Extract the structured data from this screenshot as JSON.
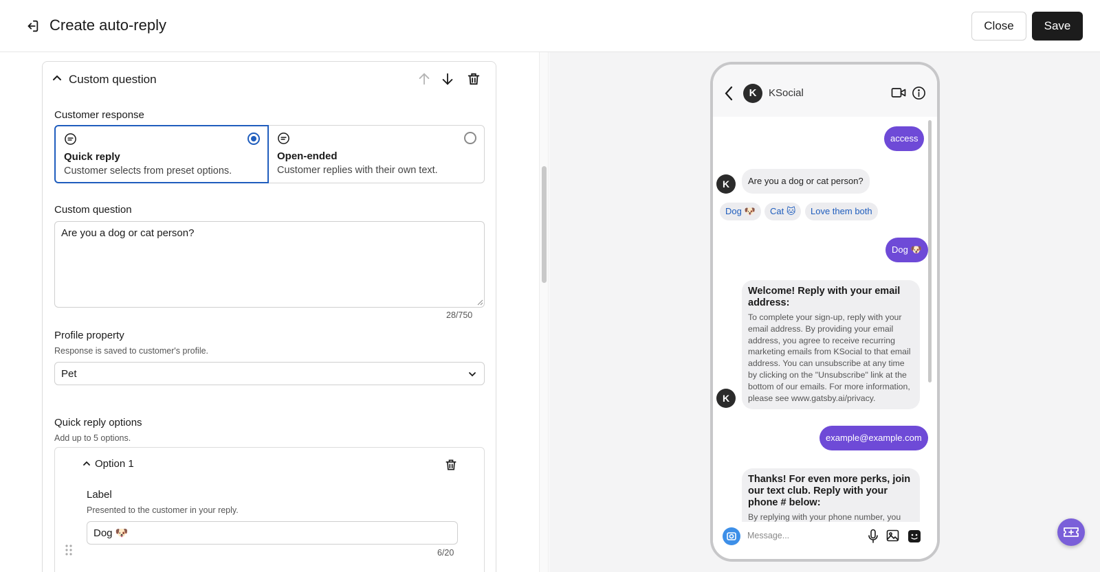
{
  "header": {
    "title": "Create auto-reply",
    "close_label": "Close",
    "save_label": "Save"
  },
  "editor": {
    "card_title": "Custom question",
    "customer_response": {
      "label": "Customer response",
      "options": [
        {
          "title": "Quick reply",
          "description": "Customer selects from preset options.",
          "selected": true
        },
        {
          "title": "Open-ended",
          "description": "Customer replies with their own text.",
          "selected": false
        }
      ]
    },
    "custom_question": {
      "label": "Custom question",
      "value": "Are you a dog or cat person?",
      "counter": "28/750"
    },
    "profile_property": {
      "label": "Profile property",
      "hint": "Response is saved to customer's profile.",
      "value": "Pet"
    },
    "quick_reply_options": {
      "label": "Quick reply options",
      "hint": "Add up to 5 options.",
      "option": {
        "title": "Option 1",
        "label_heading": "Label",
        "label_hint": "Presented to the customer in your reply.",
        "value": "Dog 🐶",
        "counter": "6/20"
      }
    }
  },
  "preview": {
    "contact_initial": "K",
    "contact_name": "KSocial",
    "messages": {
      "access": "access",
      "question": "Are you a dog or cat person?",
      "chips": [
        "Dog 🐶",
        "Cat 🐱",
        "Love them both"
      ],
      "reply_dog": "Dog 🐶",
      "welcome_title": "Welcome! Reply with your email address:",
      "welcome_body": "To complete your sign-up, reply with your email address. By providing your email address, you agree to receive recurring marketing emails from KSocial to that email address. You can unsubscribe at any time by clicking on the \"Unsubscribe\" link at the bottom of our emails. For more information, please see www.gatsby.ai/privacy.",
      "email": "example@example.com",
      "thanks_title": "Thanks! For even more perks, join our text club. Reply with your phone # below:",
      "thanks_body": "By replying with your phone number, you"
    },
    "input_placeholder": "Message..."
  },
  "colors": {
    "accent_blue": "#1f5dbd",
    "bubble_purple": "#6e4ad7",
    "fab_purple": "#7a5fd9"
  }
}
